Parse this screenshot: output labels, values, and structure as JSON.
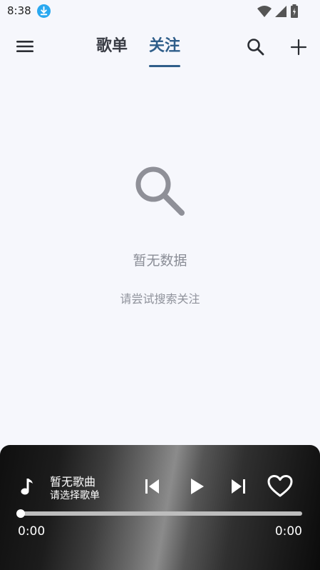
{
  "status_bar": {
    "time": "8:38",
    "icons": [
      "download-icon",
      "wifi-icon",
      "signal-icon",
      "battery-icon"
    ]
  },
  "header": {
    "tabs": [
      {
        "label": "歌单",
        "active": false
      },
      {
        "label": "关注",
        "active": true
      }
    ],
    "icons": [
      "menu-icon",
      "search-icon",
      "add-icon"
    ],
    "accent_color": "#2f5e8a"
  },
  "empty_state": {
    "icon": "search-icon",
    "title": "暂无数据",
    "subtitle": "请尝试搜索关注"
  },
  "player": {
    "title": "暂无歌曲",
    "subtitle": "请选择歌单",
    "current_time": "0:00",
    "duration": "0:00",
    "progress": 0,
    "liked": false,
    "controls": [
      "previous-icon",
      "play-icon",
      "next-icon",
      "heart-icon"
    ]
  }
}
